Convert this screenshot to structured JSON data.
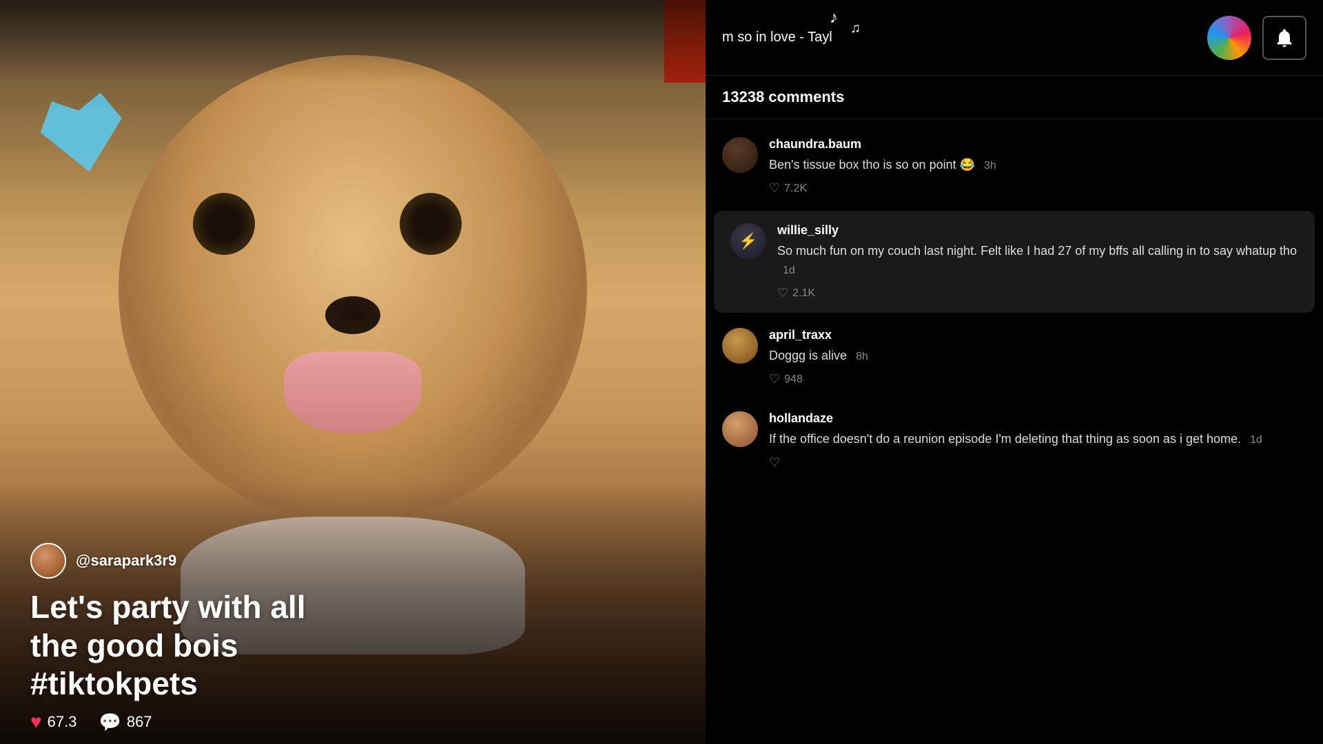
{
  "video": {
    "username": "@sarapark3r9",
    "caption": "Let's party with all\nthe good bois\n#tiktokpets",
    "likes": "67.3",
    "comments": "867"
  },
  "topBar": {
    "songText": "m so in love - Tayl",
    "note1": "♪",
    "note2": "♫"
  },
  "commentsSection": {
    "count": "13238 comments",
    "items": [
      {
        "username": "chaundra.baum",
        "text": "Ben's tissue box tho is so on point 😂",
        "timeAgo": "3h",
        "likes": "7.2K",
        "highlighted": false
      },
      {
        "username": "willie_silly",
        "text": "So much fun on my couch last night. Felt like I had 27 of my bffs all calling in to say whatup tho",
        "timeAgo": "1d",
        "likes": "2.1K",
        "highlighted": true
      },
      {
        "username": "april_traxx",
        "text": "Doggg is alive",
        "timeAgo": "8h",
        "likes": "948",
        "highlighted": false
      },
      {
        "username": "hollandaze",
        "text": "If the office doesn't do a reunion episode I'm deleting that thing as soon as i get home.",
        "timeAgo": "1d",
        "likes": "",
        "highlighted": false
      }
    ]
  },
  "icons": {
    "heart": "♥",
    "comment": "💬",
    "bell": "bell",
    "musicNote": "♪"
  }
}
